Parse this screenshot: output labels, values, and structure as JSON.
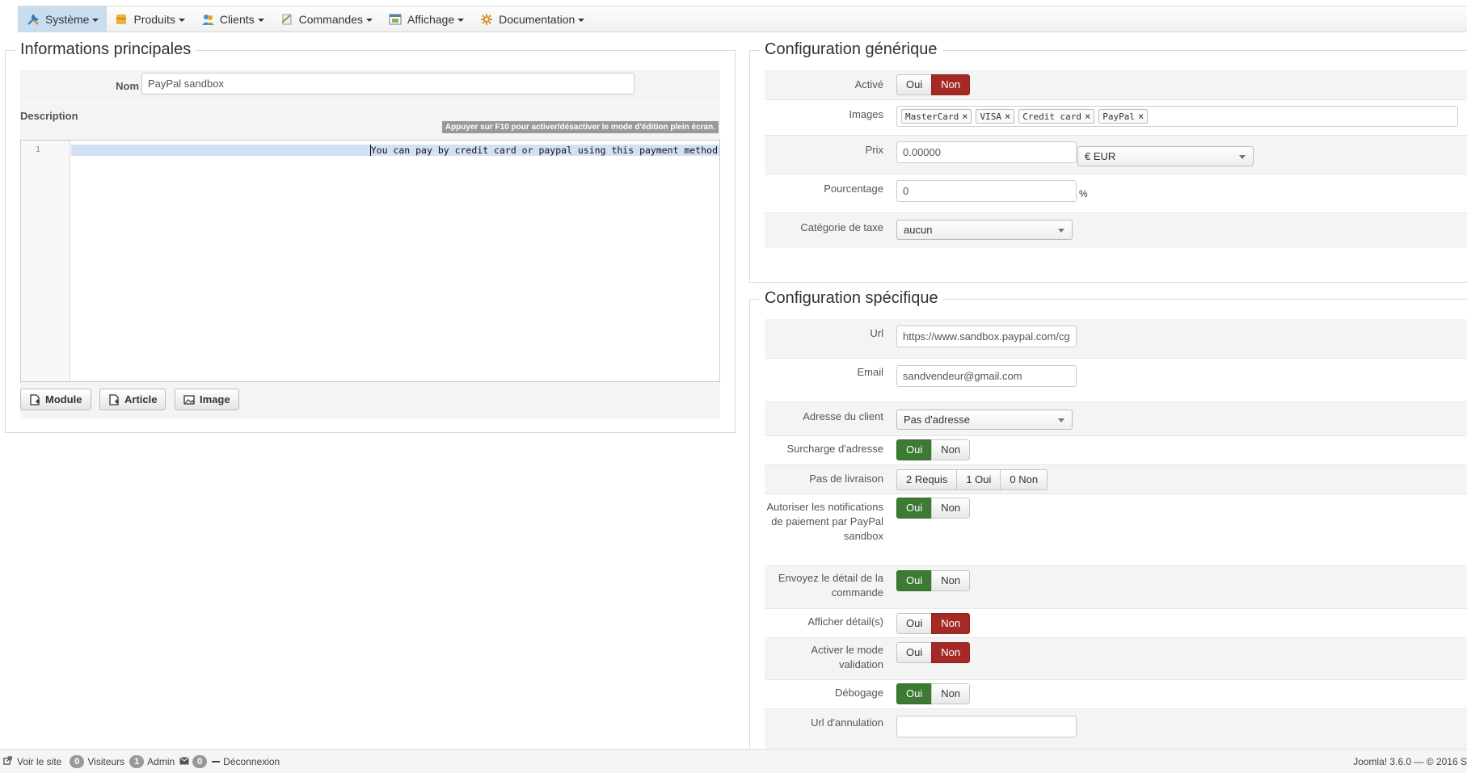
{
  "menu": [
    {
      "label": "Système",
      "icon": "wrench-icon",
      "color": "#3a78b5",
      "active": true
    },
    {
      "label": "Produits",
      "icon": "products-icon",
      "color": "#e8a023"
    },
    {
      "label": "Clients",
      "icon": "clients-icon",
      "color": "#4a8fd0"
    },
    {
      "label": "Commandes",
      "icon": "orders-icon",
      "color": "#7fa24b"
    },
    {
      "label": "Affichage",
      "icon": "display-icon",
      "color": "#5b7fa8"
    },
    {
      "label": "Documentation",
      "icon": "documentation-icon",
      "color": "#d9922e"
    }
  ],
  "main_info": {
    "title": "Informations principales",
    "nom_label": "Nom",
    "nom_value": "PayPal sandbox",
    "description_label": "Description",
    "fullscreen_hint": "Appuyer sur F10 pour activer/désactiver le mode d'édition plein écran.",
    "editor_line_number": "1",
    "editor_text": "You can pay by credit card or paypal using this payment method",
    "buttons": {
      "module": "Module",
      "article": "Article",
      "image": "Image"
    }
  },
  "generic": {
    "title": "Configuration générique",
    "active_label": "Activé",
    "active_yes": "Oui",
    "active_no": "Non",
    "images_label": "Images",
    "images": [
      "MasterCard",
      "VISA",
      "Credit card",
      "PayPal"
    ],
    "price_label": "Prix",
    "price_value": "0.00000",
    "currency": "€ EUR",
    "percent_label": "Pourcentage",
    "percent_value": "0",
    "percent_unit": "%",
    "tax_label": "Catégorie de taxe",
    "tax_value": "aucun"
  },
  "specific": {
    "title": "Configuration spécifique",
    "url_label": "Url",
    "url_value": "https://www.sandbox.paypal.com/cg",
    "email_label": "Email",
    "email_value": "sandvendeur@gmail.com",
    "address_label": "Adresse du client",
    "address_value": "Pas d'adresse",
    "surcharge_label": "Surcharge d'adresse",
    "shipping_label": "Pas de livraison",
    "shipping_opts": [
      "2 Requis",
      "1 Oui",
      "0 Non"
    ],
    "notif_label": "Autoriser les notifications de paiement par PayPal sandbox",
    "send_detail_label": "Envoyez le détail de la commande",
    "show_detail_label": "Afficher détail(s)",
    "validation_label": "Activer le mode validation",
    "debug_label": "Débogage",
    "cancel_url_label": "Url d'annulation",
    "yes": "Oui",
    "no": "Non"
  },
  "status": {
    "view_site": "Voir le site",
    "visitors_count": "0",
    "visitors_label": "Visiteurs",
    "admin_count": "1",
    "admin_label": "Admin",
    "messages_count": "0",
    "logout": "Déconnexion",
    "version": "Joomla! 3.6.0 — © 2016 S"
  },
  "colors": {
    "green": "#3d7a34",
    "red": "#a42b25",
    "active_menu": "#c8def0"
  }
}
